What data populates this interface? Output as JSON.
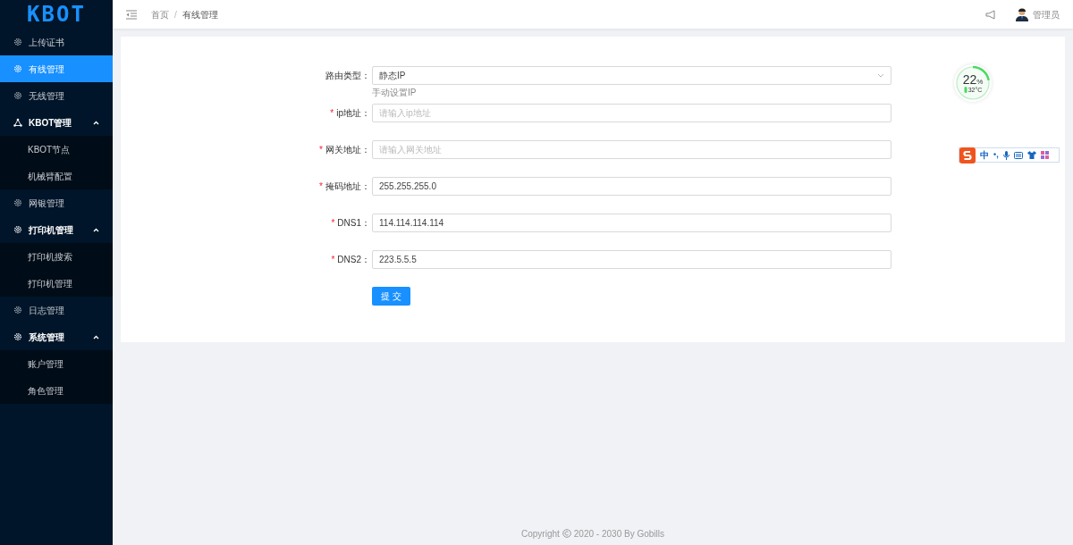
{
  "logo": "KBOT",
  "sidebar": {
    "items": [
      {
        "kind": "item",
        "label": "上传证书",
        "selected": false
      },
      {
        "kind": "item",
        "label": "有线管理",
        "selected": true
      },
      {
        "kind": "item",
        "label": "无线管理",
        "selected": false
      },
      {
        "kind": "node-group",
        "label": "KBOT管理",
        "expanded": true,
        "children": [
          {
            "label": "KBOT节点",
            "selected": false
          },
          {
            "label": "机械臂配置",
            "selected": false
          }
        ]
      },
      {
        "kind": "item",
        "label": "网银管理",
        "selected": false
      },
      {
        "kind": "group",
        "label": "打印机管理",
        "expanded": true,
        "children": [
          {
            "label": "打印机搜索",
            "selected": false
          },
          {
            "label": "打印机管理",
            "selected": false
          }
        ]
      },
      {
        "kind": "item",
        "label": "日志管理",
        "selected": false
      },
      {
        "kind": "group",
        "label": "系统管理",
        "expanded": true,
        "children": [
          {
            "label": "账户管理",
            "selected": false
          },
          {
            "label": "角色管理",
            "selected": false
          }
        ]
      }
    ]
  },
  "breadcrumb": {
    "items": [
      "首页",
      "有线管理"
    ],
    "separator": "/"
  },
  "user": "管理员",
  "form": {
    "fields": [
      {
        "kind": "select",
        "label": "路由类型：",
        "value": "静态IP",
        "hint": "手动设置IP"
      },
      {
        "kind": "input",
        "label": "ip地址：",
        "required_mark": "*",
        "placeholder": "请输入ip地址"
      },
      {
        "kind": "input",
        "label": "网关地址：",
        "required_mark": "*",
        "placeholder": "请输入网关地址"
      },
      {
        "kind": "input",
        "label": "掩码地址：",
        "required_mark": "*",
        "value": "255.255.255.0"
      },
      {
        "kind": "input",
        "label": "DNS1：",
        "required_mark": "*",
        "value": "114.114.114.114"
      },
      {
        "kind": "input",
        "label": "DNS2：",
        "required_mark": "*",
        "value": "223.5.5.5"
      }
    ],
    "submit": "提 交"
  },
  "monitor": {
    "percent": "22",
    "unit": "%",
    "level": 0.22,
    "temperature": "32°C"
  },
  "ime_toolbar": {
    "mode": "中",
    "punctuation": "•,"
  },
  "footer": {
    "before": "Copyright",
    "after": "2020 - 2030 By Gobills"
  }
}
